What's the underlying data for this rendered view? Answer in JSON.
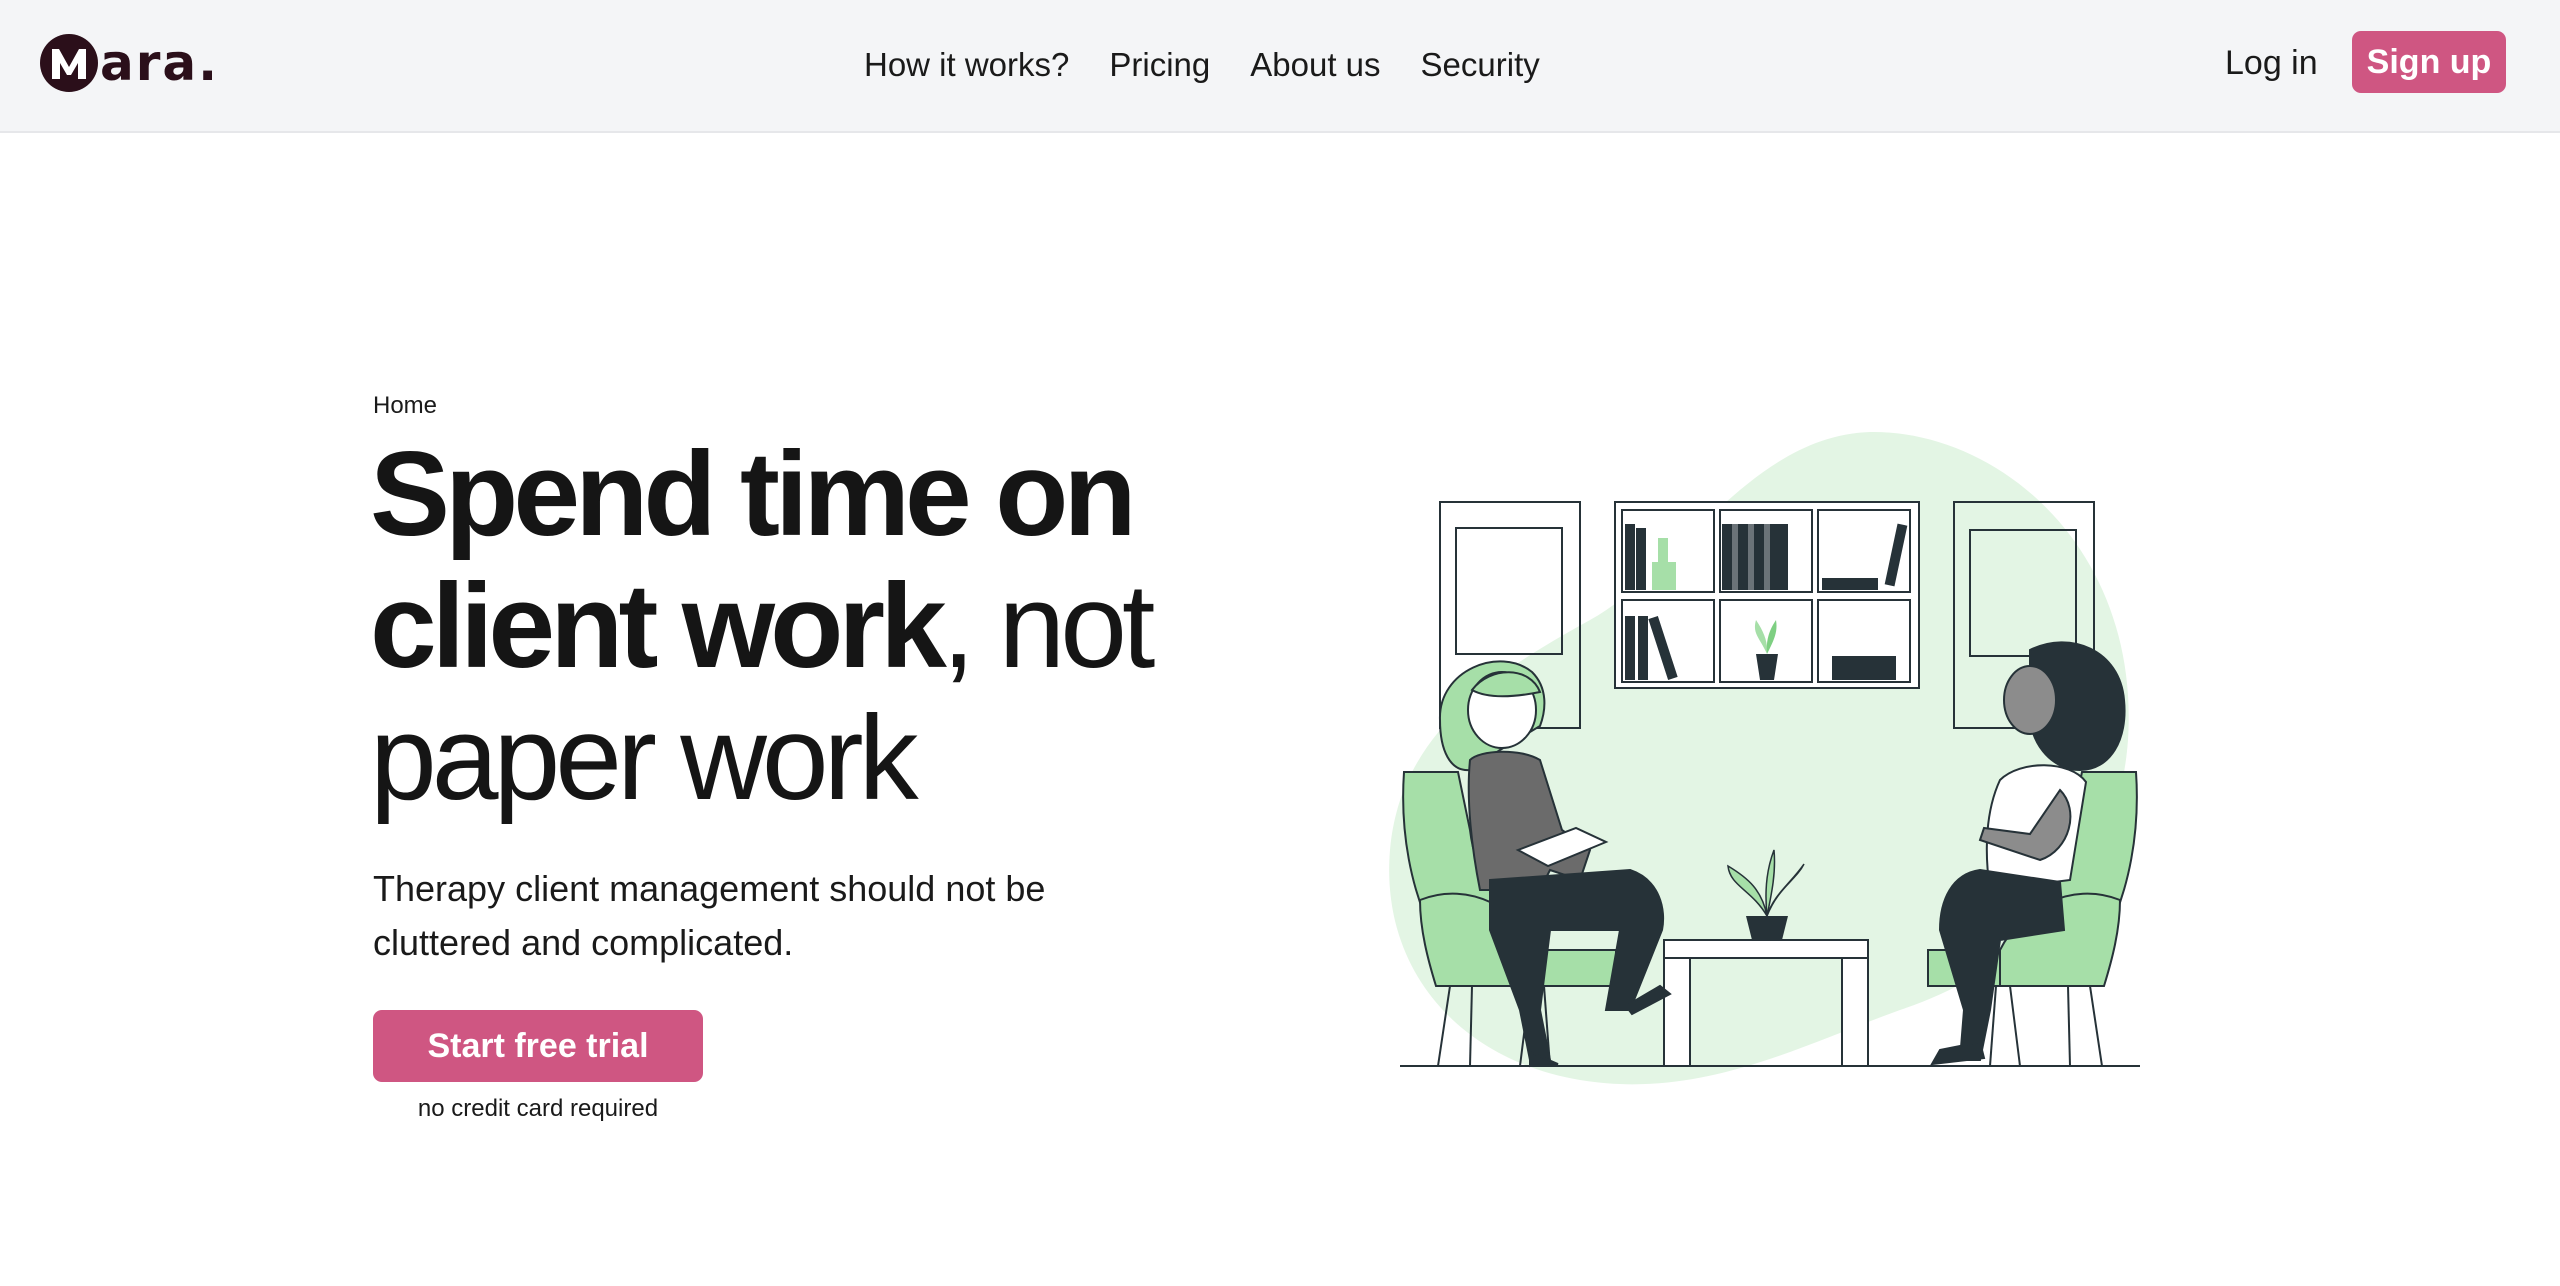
{
  "brand": {
    "logo_letter": "M",
    "name": "ara.",
    "color": "#2b0f1a"
  },
  "nav": {
    "items": [
      {
        "label": "How it works?"
      },
      {
        "label": "Pricing"
      },
      {
        "label": "About us"
      },
      {
        "label": "Security"
      }
    ],
    "login_label": "Log in",
    "signup_label": "Sign up"
  },
  "hero": {
    "breadcrumb": "Home",
    "headline": {
      "bold_part": "Spend time on client work",
      "rest": ", not paper work"
    },
    "subtitle": "Therapy client management should not be cluttered and complicated.",
    "cta_label": "Start free trial",
    "cta_note": "no credit card required"
  },
  "colors": {
    "accent": "#cf5682",
    "header_bg": "#f4f5f7",
    "illustration_green": "#a6dfa8",
    "illustration_blob": "#e3f5e4",
    "illustration_dark": "#263238"
  },
  "illustration": {
    "subject": "therapy-session-illustration"
  }
}
